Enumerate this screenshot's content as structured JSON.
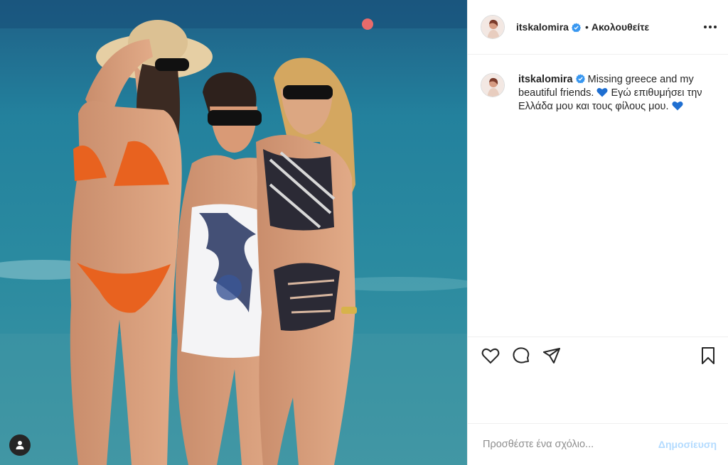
{
  "post": {
    "username": "itskalomira",
    "follow_separator": "•",
    "follow_label": "Ακολουθείτε",
    "caption": {
      "username": "itskalomira",
      "text_part1": "Missing greece and my beautiful friends.",
      "text_part2": "Εγώ επιθυμήσει την Ελλάδα μου και τους φίλους μου."
    },
    "comment_placeholder": "Προσθέστε ένα σχόλιο...",
    "post_button_label": "Δημοσίευση"
  },
  "colors": {
    "verified": "#3897f0",
    "heart_emoji": "#1f6fd1",
    "post_button_disabled": "#b3dbff"
  },
  "icons": [
    "verified-badge-icon",
    "more-options-icon",
    "like-icon",
    "comment-icon",
    "share-icon",
    "save-icon",
    "user-tag-icon",
    "blue-heart-icon"
  ]
}
